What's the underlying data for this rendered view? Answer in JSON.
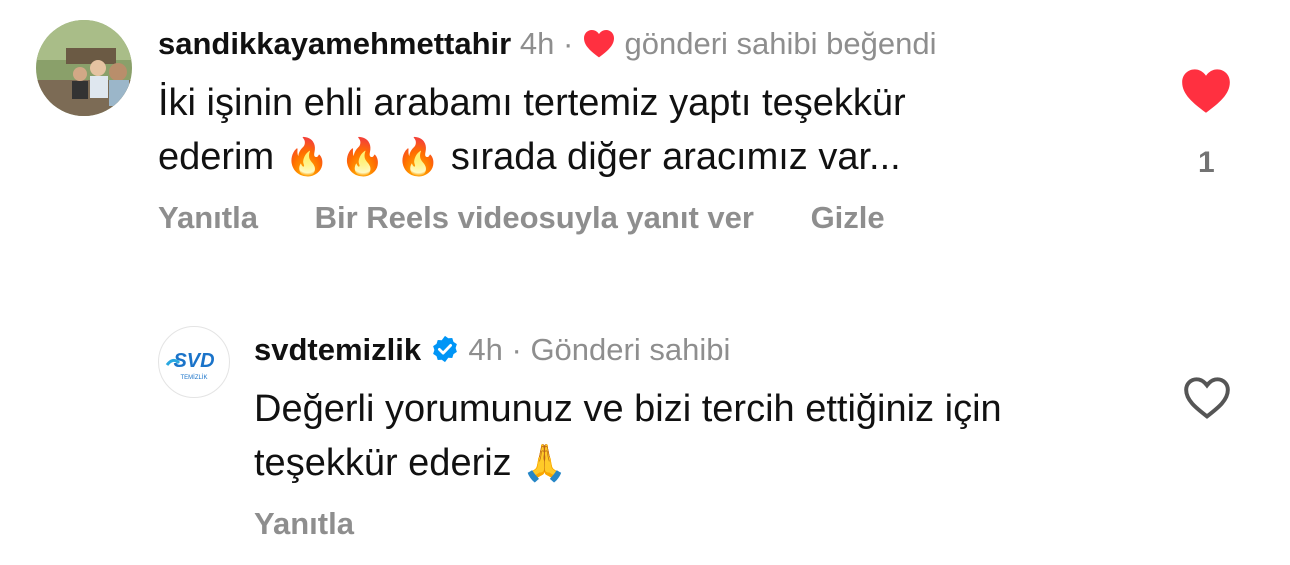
{
  "comment1": {
    "username": "sandikkayamehmettahir",
    "time": "4h",
    "separator": "·",
    "liked_by_author": "gönderi sahibi beğendi",
    "text_line1": "İki işinin ehli arabamı tertemiz yaptı teşekkür",
    "text_line2_start": "ederim",
    "emoji": "🔥",
    "text_line2_end": "sırada diğer aracımız var...",
    "like_count": "1",
    "actions": {
      "reply": "Yanıtla",
      "reels_reply": "Bir Reels videosuyla yanıt ver",
      "hide": "Gizle"
    },
    "liked": true
  },
  "comment2": {
    "username": "svdtemizlik",
    "verified": true,
    "time": "4h",
    "separator": "·",
    "role": "Gönderi sahibi",
    "text_line1": "Değerli yorumunuz ve bizi tercih ettiğiniz için",
    "text_line2": "teşekkür ederiz",
    "emoji": "🙏",
    "logo_text": "SVD",
    "logo_subtext": "TEMİZLİK",
    "actions": {
      "reply": "Yanıtla"
    },
    "liked": false
  },
  "colors": {
    "like_red": "#ff3040",
    "muted": "#8e8e8e",
    "verified_blue": "#0095f6"
  },
  "icons": [
    "heart-filled-icon",
    "heart-outline-icon",
    "verified-badge-icon",
    "fire-emoji",
    "pray-emoji"
  ]
}
